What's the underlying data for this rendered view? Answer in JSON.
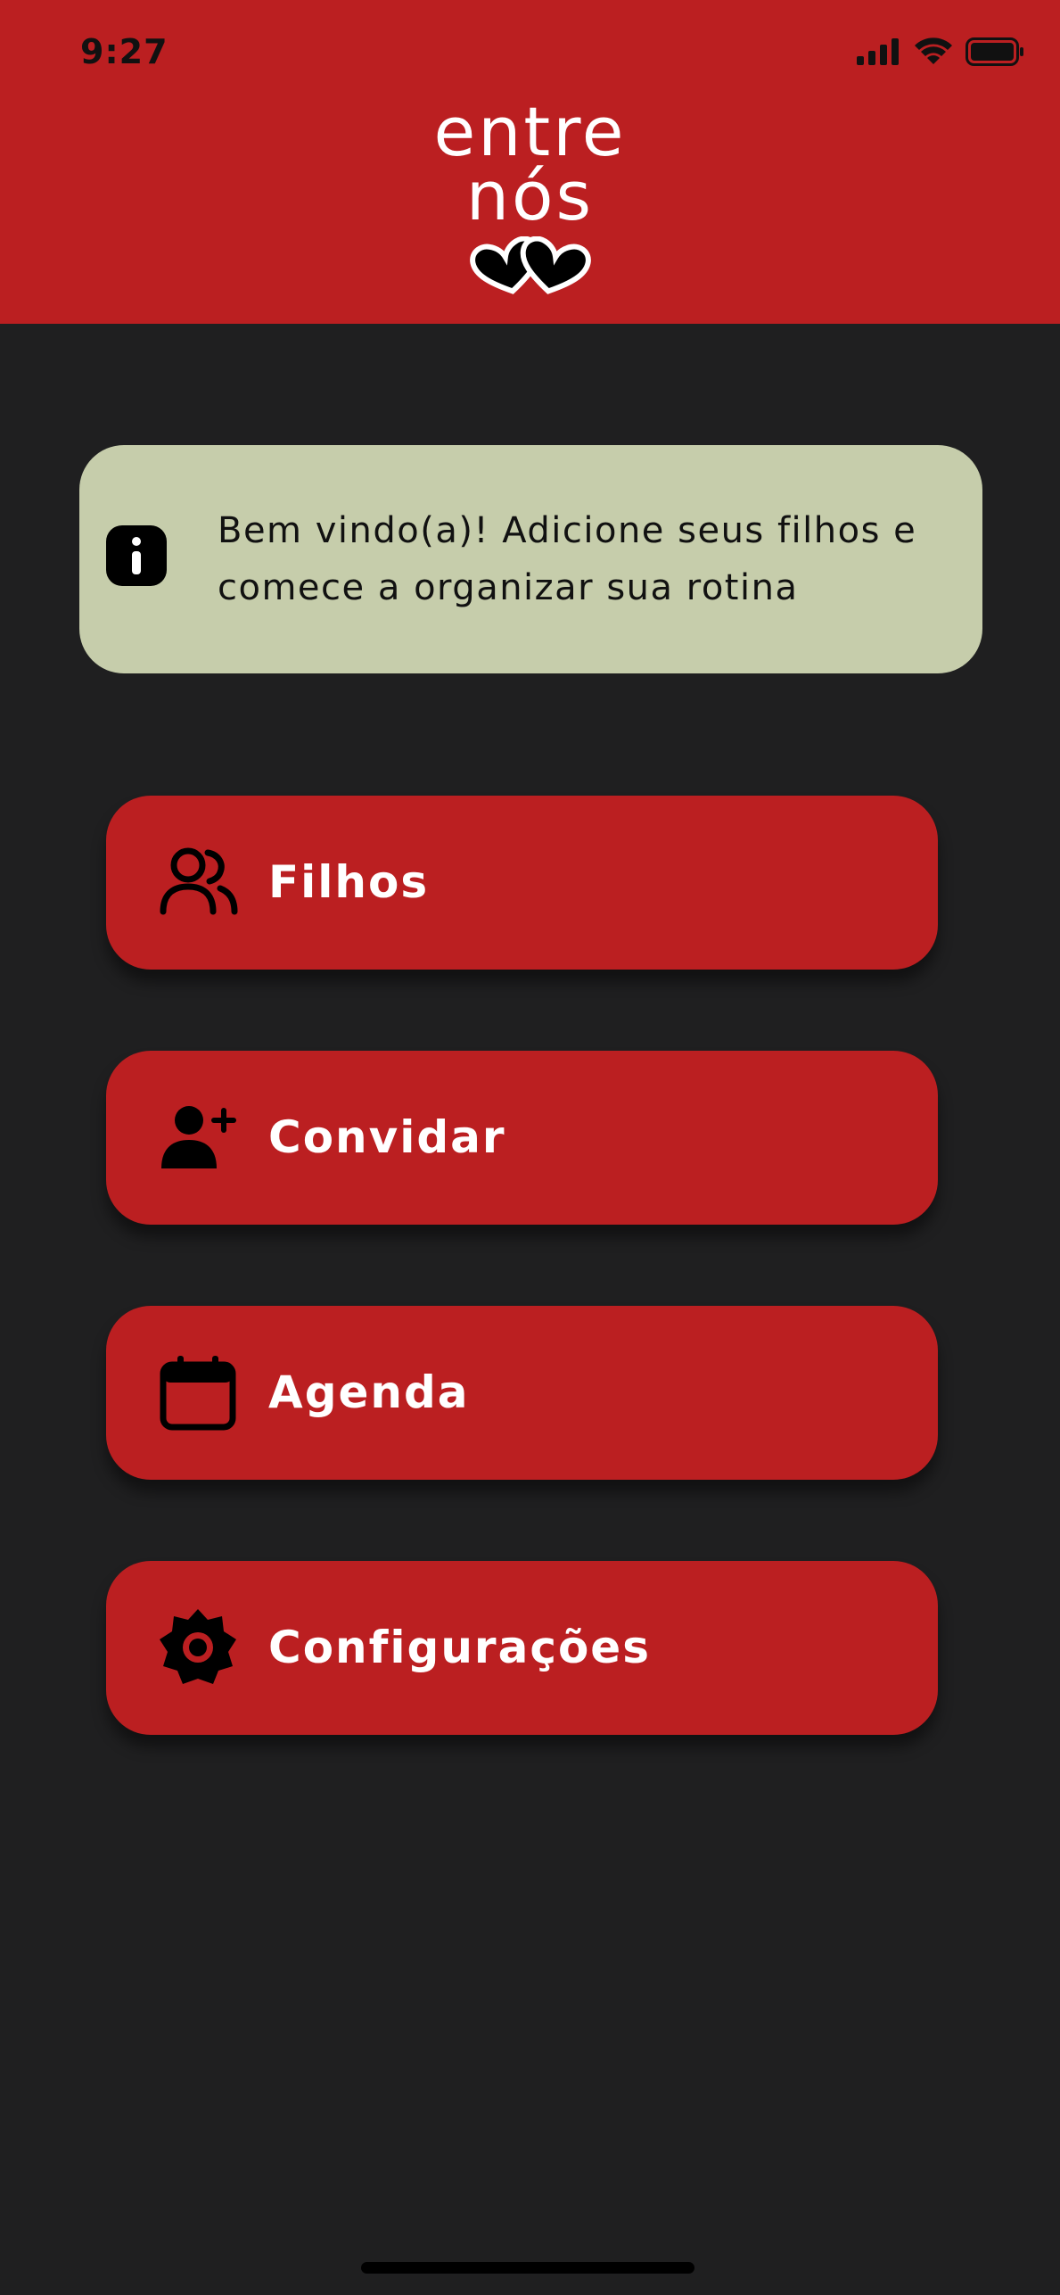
{
  "status_bar": {
    "time": "9:27"
  },
  "header": {
    "logo_line1": "entre",
    "logo_line2": "nós",
    "logo_hearts": "two-hearts-logo"
  },
  "info_banner": {
    "icon": "info-icon",
    "text": "Bem vindo(a)! Adicione seus filhos e comece a organizar sua rotina"
  },
  "menu": [
    {
      "label": "Filhos",
      "icon": "users-icon"
    },
    {
      "label": "Convidar",
      "icon": "user-plus-icon"
    },
    {
      "label": "Agenda",
      "icon": "calendar-icon"
    },
    {
      "label": "Configurações",
      "icon": "settings-gear-icon"
    }
  ],
  "colors": {
    "header": "#bb1f21",
    "background": "#1f1f20",
    "info_card": "#c6cdab",
    "button": "#bb1f21",
    "button_text": "#ffffff"
  }
}
